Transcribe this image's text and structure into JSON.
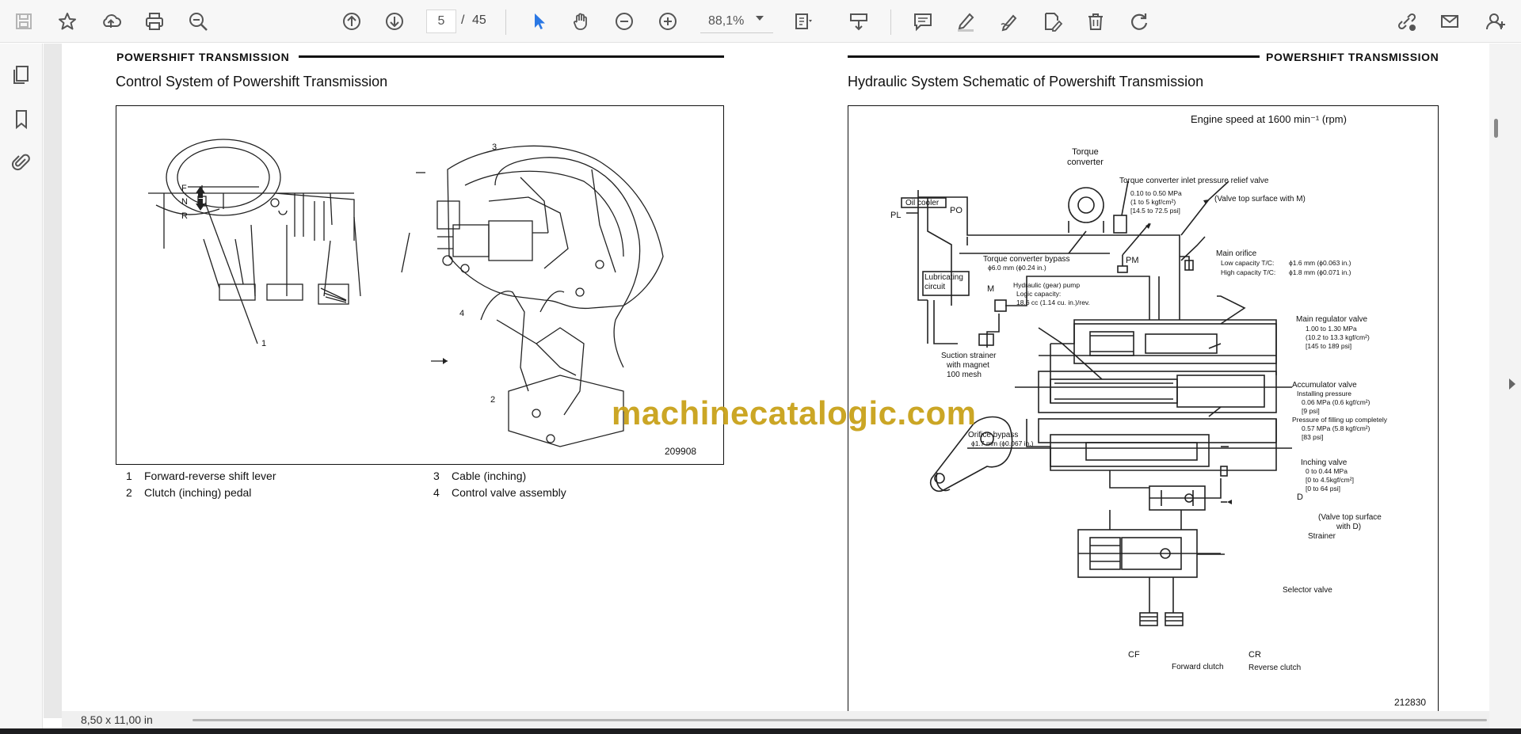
{
  "toolbar": {
    "page_current": "5",
    "page_separator": "/",
    "page_total": "45",
    "zoom": "88,1%"
  },
  "left_page": {
    "header": "POWERSHIFT  TRANSMISSION",
    "title": "Control System of Powershift Transmission",
    "figure_code": "209908",
    "callouts": {
      "n1": "1",
      "n2": "2",
      "n3": "3",
      "n4": "4",
      "f": "F",
      "n": "N",
      "r": "R"
    },
    "legend": [
      {
        "num": "1",
        "text": "Forward-reverse shift lever"
      },
      {
        "num": "2",
        "text": "Clutch (inching) pedal"
      },
      {
        "num": "3",
        "text": "Cable (inching)"
      },
      {
        "num": "4",
        "text": "Control valve assembly"
      }
    ]
  },
  "right_page": {
    "header": "POWERSHIFT  TRANSMISSION",
    "title": "Hydraulic System Schematic of Powershift Transmission",
    "figure_code": "212830",
    "engine_speed": "Engine speed at 1600 min⁻¹ (rpm)",
    "labels": {
      "torque_converter": "Torque\nconverter",
      "tc_relief_valve": "Torque converter inlet pressure relief valve",
      "tc_relief_v1": "0.10 to 0.50 MPa",
      "tc_relief_v2": "(1 to 5 kgf/cm²)",
      "tc_relief_v3": "[14.5 to 72.5 psi]",
      "valve_top_m": "(Valve top surface with M)",
      "oil_cooler": "Oil cooler",
      "pl": "PL",
      "po": "PO",
      "pm": "PM",
      "m": "M",
      "d": "D",
      "tc_bypass": "Torque converter bypass",
      "tc_bypass_v": "ϕ6.0 mm (ϕ0.24 in.)",
      "main_orifice": "Main orifice",
      "main_orifice_low": "Low capacity T/C:",
      "main_orifice_low_v": "ϕ1.6 mm (ϕ0.063 in.)",
      "main_orifice_high": "High capacity T/C:",
      "main_orifice_high_v": "ϕ1.8 mm (ϕ0.071 in.)",
      "lubricating": "Lubricating\ncircuit",
      "pump": "Hydraulic (gear) pump",
      "pump_cap": "Logic capacity:",
      "pump_cap_v": "18.6 cc (1.14 cu. in.)/rev.",
      "main_regulator": "Main regulator valve",
      "main_reg_v1": "1.00 to 1.30 MPa",
      "main_reg_v2": "(10.2 to 13.3 kgf/cm²)",
      "main_reg_v3": "[145 to 189 psi]",
      "suction_strainer": "Suction strainer",
      "suction_magnet": "with magnet",
      "suction_mesh": "100 mesh",
      "accumulator": "Accumulator valve",
      "acc_install": "Installing pressure",
      "acc_install_v1": "0.06 MPa (0.6 kgf/cm²)",
      "acc_install_v2": "[9 psi]",
      "acc_fill": "Pressure of filling up completely",
      "acc_fill_v1": "0.57 MPa (5.8 kgf/cm²)",
      "acc_fill_v2": "[83 psi]",
      "orifice_bypass": "Orifice bypass",
      "orifice_bypass_v": "ϕ1.7 mm (ϕ0.067 in.)",
      "inching": "Inching valve",
      "inching_v1": "0 to 0.44 MPa",
      "inching_v2": "[0 to 4.5kgf/cm²]",
      "inching_v3": "[0 to 64 psi]",
      "valve_top_d1": "(Valve top surface",
      "valve_top_d2": "with D)",
      "strainer": "Strainer",
      "selector": "Selector valve",
      "cf": "CF",
      "cr": "CR",
      "forward_clutch": "Forward clutch",
      "reverse_clutch": "Reverse clutch"
    }
  },
  "watermark": "machinecatalogic.com",
  "status": {
    "page_size": "8,50 x 11,00 in"
  },
  "colors": {
    "watermark": "#c9a21a",
    "toolbar_bg": "#f7f7f7",
    "icon": "#555555",
    "select_tool": "#2b78e4"
  }
}
